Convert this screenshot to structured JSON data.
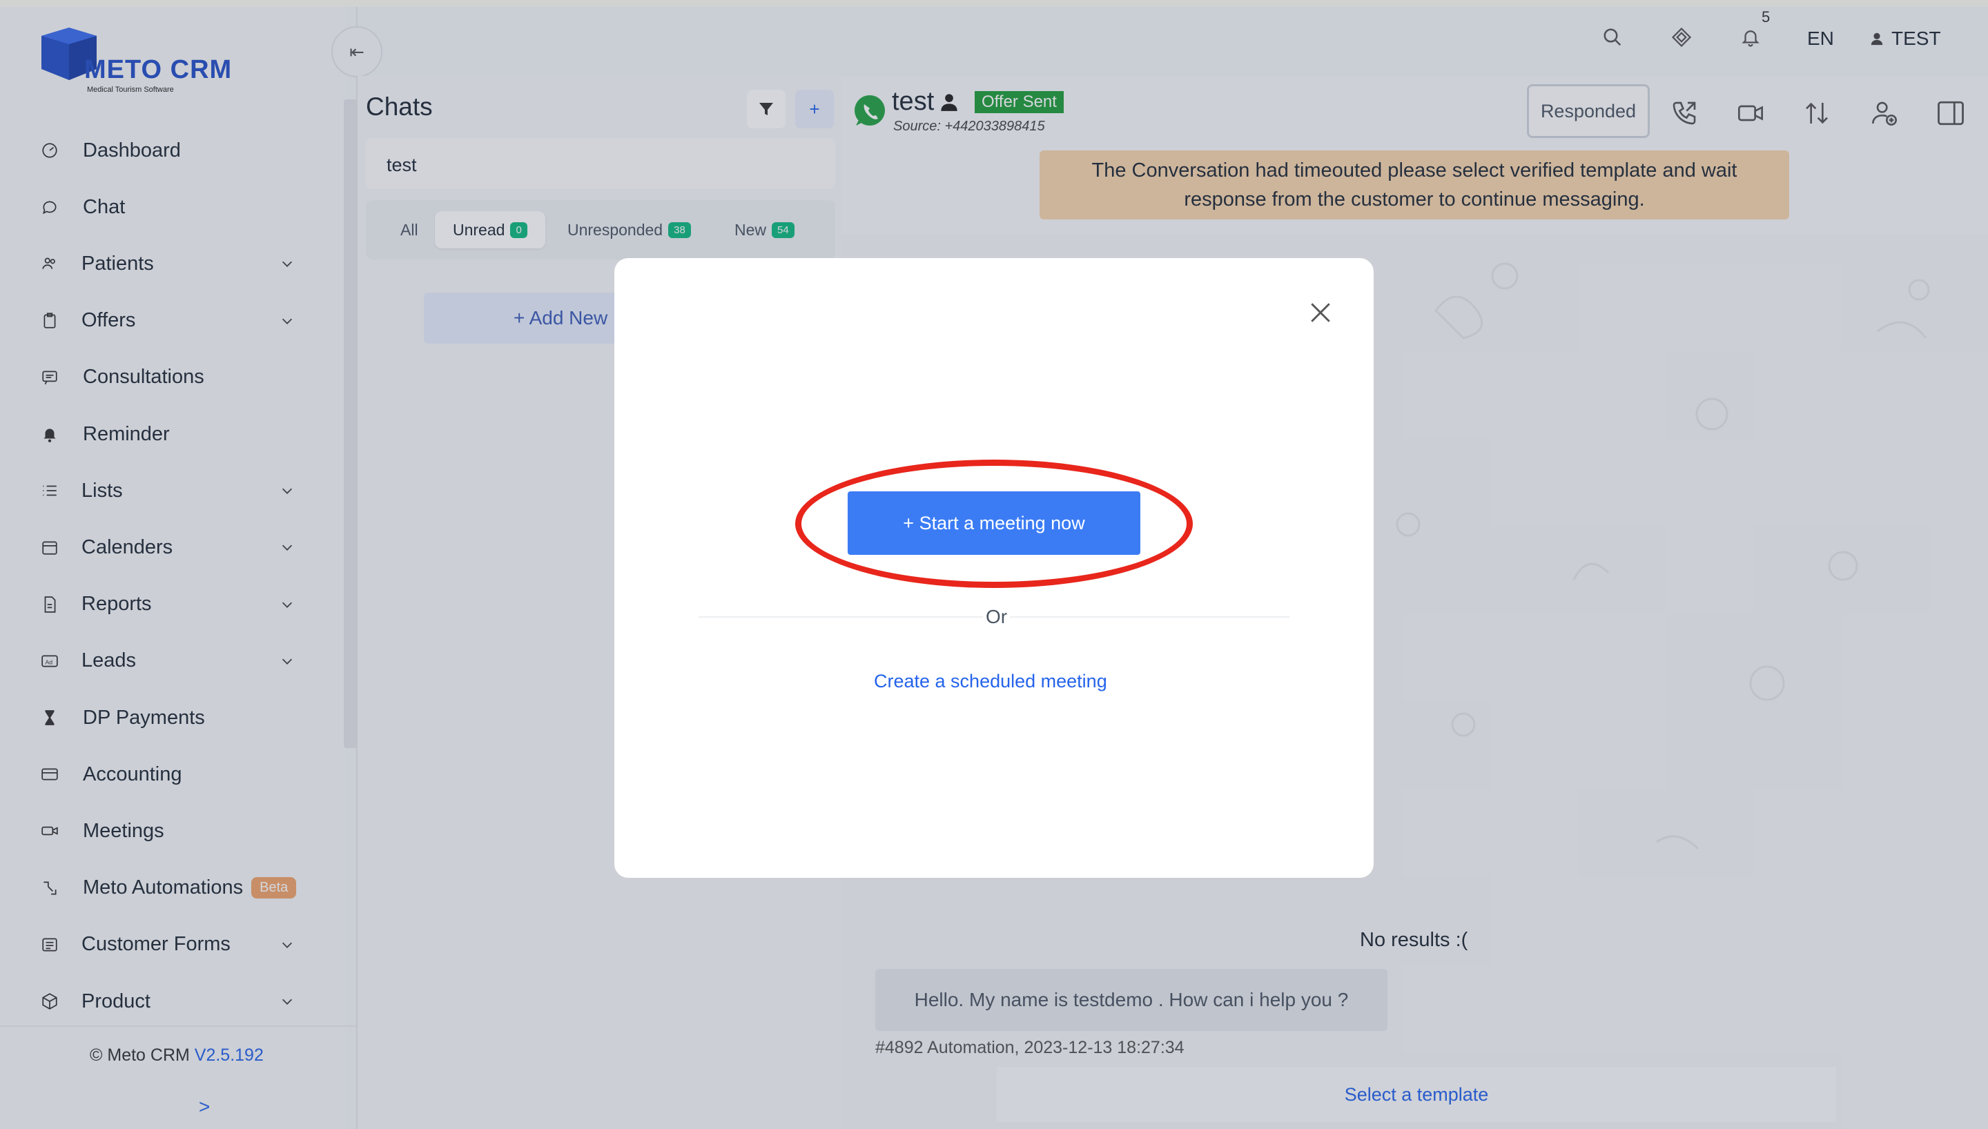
{
  "brand": {
    "name": "METO CRM",
    "tagline": "Medical Tourism Software",
    "primary_color": "#2563eb"
  },
  "sidebar": {
    "items": [
      {
        "label": "Dashboard",
        "icon": "dashboard-icon",
        "has_submenu": false
      },
      {
        "label": "Chat",
        "icon": "chat-bubble-icon",
        "has_submenu": false
      },
      {
        "label": "Patients",
        "icon": "patients-icon",
        "has_submenu": true
      },
      {
        "label": "Offers",
        "icon": "clipboard-icon",
        "has_submenu": true
      },
      {
        "label": "Consultations",
        "icon": "consultation-icon",
        "has_submenu": false
      },
      {
        "label": "Reminder",
        "icon": "bell-icon",
        "has_submenu": false
      },
      {
        "label": "Lists",
        "icon": "list-icon",
        "has_submenu": true
      },
      {
        "label": "Calenders",
        "icon": "calendar-icon",
        "has_submenu": true
      },
      {
        "label": "Reports",
        "icon": "report-icon",
        "has_submenu": true
      },
      {
        "label": "Leads",
        "icon": "ad-icon",
        "has_submenu": true
      },
      {
        "label": "DP Payments",
        "icon": "hourglass-icon",
        "has_submenu": false
      },
      {
        "label": "Accounting",
        "icon": "card-icon",
        "has_submenu": false
      },
      {
        "label": "Meetings",
        "icon": "video-icon",
        "has_submenu": false
      },
      {
        "label": "Meto Automations",
        "icon": "automation-icon",
        "has_submenu": false,
        "badge": "Beta"
      },
      {
        "label": "Customer Forms",
        "icon": "form-icon",
        "has_submenu": true
      },
      {
        "label": "Product",
        "icon": "box-icon",
        "has_submenu": true
      }
    ],
    "footer_prefix": "© Meto CRM",
    "footer_version": "V2.5.192",
    "expand_label": ">"
  },
  "header": {
    "notification_count": "5",
    "language": "EN",
    "user_name": "TEST"
  },
  "chats": {
    "title": "Chats",
    "search_value": "test",
    "tabs": [
      {
        "label": "All",
        "count": null,
        "active": false
      },
      {
        "label": "Unread",
        "count": "0",
        "active": true
      },
      {
        "label": "Unresponded",
        "count": "38",
        "active": false
      },
      {
        "label": "New",
        "count": "54",
        "active": false
      }
    ],
    "add_new_label": "+ Add New"
  },
  "conversation": {
    "contact_name": "test",
    "status_badge": "Offer Sent",
    "source": "Source: +442033898415",
    "responded_label": "Responded",
    "warning": "The Conversation had timeouted please select verified template and wait response from the customer to continue messaging.",
    "no_results": "No results :(",
    "message_text": "Hello. My name is testdemo . How can i help you ?",
    "message_meta": "#4892 Automation, 2023-12-13 18:27:34",
    "select_template_label": "Select a template"
  },
  "modal": {
    "start_meeting_label": "+ Start a meeting now",
    "or_label": "Or",
    "scheduled_label": "Create a scheduled meeting",
    "highlight_color": "#e8261c"
  }
}
